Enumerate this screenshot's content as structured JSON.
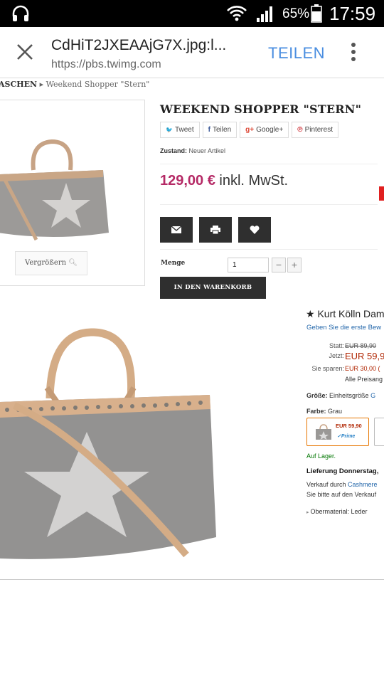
{
  "status_bar": {
    "battery_percent": "65%",
    "time": "17:59",
    "icons": [
      "headphones-icon",
      "wifi-icon",
      "signal-icon",
      "battery-icon"
    ]
  },
  "browser": {
    "title": "CdHiT2JXEAAjG7X.jpg:l...",
    "url": "https://pbs.twimg.com",
    "share_label": "TEILEN",
    "accent_color": "#4a8ee0"
  },
  "breadcrumb": {
    "parent": "ASCHEN",
    "separator": "▸",
    "current": "Weekend Shopper \"Stern\""
  },
  "thumbnail": {
    "zoom_label": "Vergrößern"
  },
  "product": {
    "title": "WEEKEND SHOPPER \"STERN\"",
    "social_buttons": [
      {
        "icon": "twitter-icon",
        "glyph": "🐦",
        "label": "Tweet",
        "color": "#1da1f2"
      },
      {
        "icon": "facebook-icon",
        "glyph": "f",
        "label": "Teilen",
        "color": "#3b5998"
      },
      {
        "icon": "googleplus-icon",
        "glyph": "g+",
        "label": "Google+",
        "color": "#dd4b39"
      },
      {
        "icon": "pinterest-icon",
        "glyph": "℗",
        "label": "Pinterest",
        "color": "#cb2027"
      }
    ],
    "condition_label": "Zustand:",
    "condition_value": "Neuer Artikel",
    "price": "129,00 €",
    "price_suffix": " inkl. MwSt.",
    "price_color": "#b52a66",
    "quantity_label": "Menge",
    "quantity_value": "1",
    "qty_minus": "−",
    "qty_plus": "+",
    "cart_label": "IN DEN WARENKORB",
    "action_icons": [
      "envelope-icon",
      "print-icon",
      "heart-icon"
    ]
  },
  "amazon": {
    "brand": "★ Kurt Kölln Dam",
    "rating_link": "Geben Sie die erste Bew",
    "statt_label": "Statt:",
    "statt_value": "EUR 89,90",
    "jetzt_label": "Jetzt:",
    "jetzt_value": "EUR 59,9",
    "sparen_label": "Sie sparen:",
    "sparen_value": "EUR 30,00 (",
    "alle_preise": "Alle Preisang",
    "groesse_label": "Größe:",
    "groesse_value": "Einheitsgröße",
    "farbe_label": "Farbe:",
    "farbe_value": "Grau",
    "swatch_price": "EUR 59,90",
    "swatch_prime": "✓Prime",
    "auf_lager": "Auf Lager.",
    "lieferung": "Lieferung Donnerstag, ",
    "verkauf_prefix": "Verkauf durch ",
    "verkauf_link": "Cashmere",
    "bitte": "Sie bitte auf den Verkauf",
    "bullet": "Obermaterial: Leder"
  }
}
